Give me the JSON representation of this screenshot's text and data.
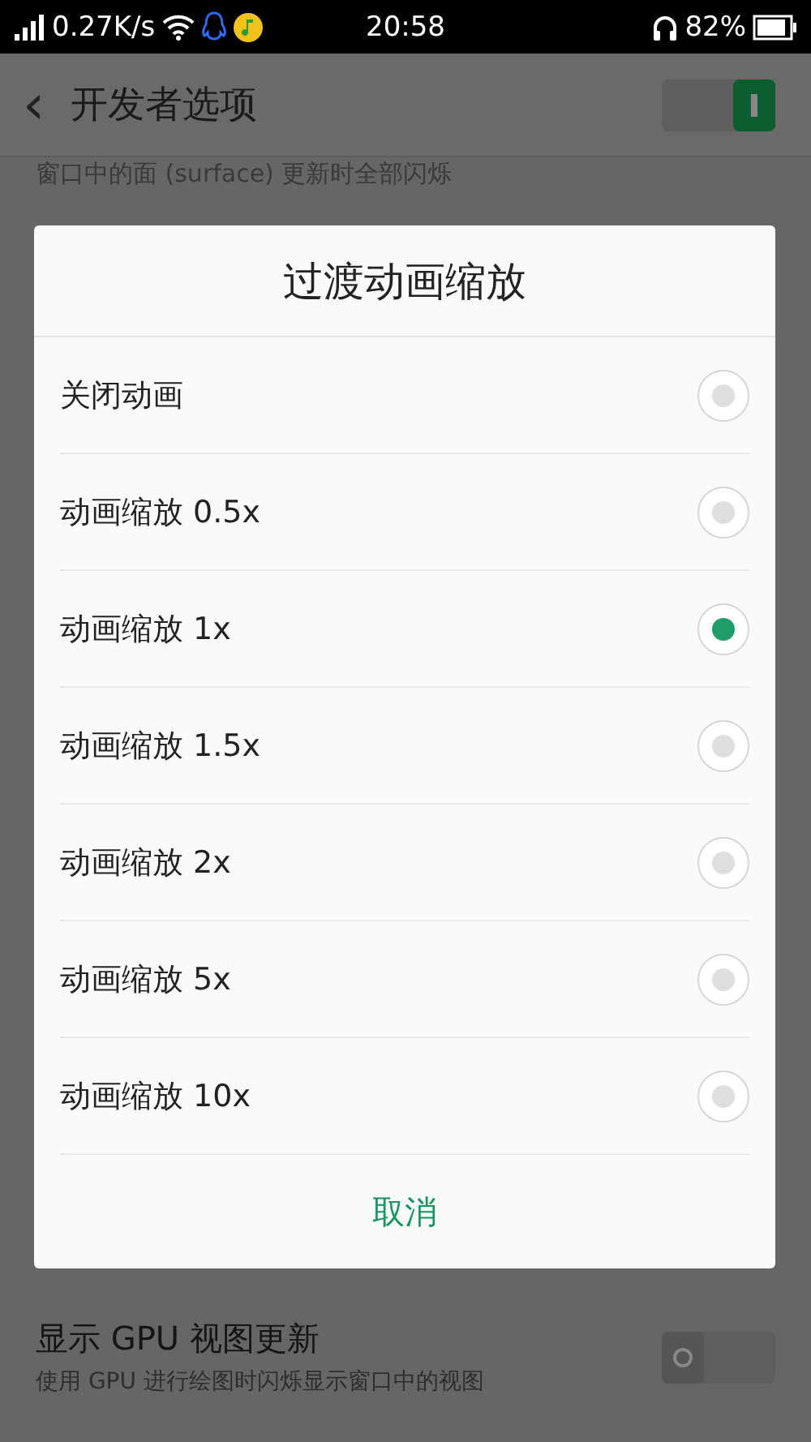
{
  "status_bar": {
    "speed": "0.27K/s",
    "time": "20:58",
    "battery": "82%"
  },
  "header": {
    "back": "‹",
    "title": "开发者选项",
    "master_switch": {
      "on": true
    }
  },
  "background_text": "窗口中的面 (surface) 更新时全部闪烁",
  "dialog": {
    "title": "过渡动画缩放",
    "options": [
      {
        "label": "关闭动画",
        "selected": false
      },
      {
        "label": "动画缩放 0.5x",
        "selected": false
      },
      {
        "label": "动画缩放 1x",
        "selected": true
      },
      {
        "label": "动画缩放 1.5x",
        "selected": false
      },
      {
        "label": "动画缩放 2x",
        "selected": false
      },
      {
        "label": "动画缩放 5x",
        "selected": false
      },
      {
        "label": "动画缩放 10x",
        "selected": false
      }
    ],
    "cancel": "取消"
  },
  "setting": {
    "title": "显示 GPU 视图更新",
    "description": "使用 GPU 进行绘图时闪烁显示窗口中的视图",
    "on": false
  }
}
